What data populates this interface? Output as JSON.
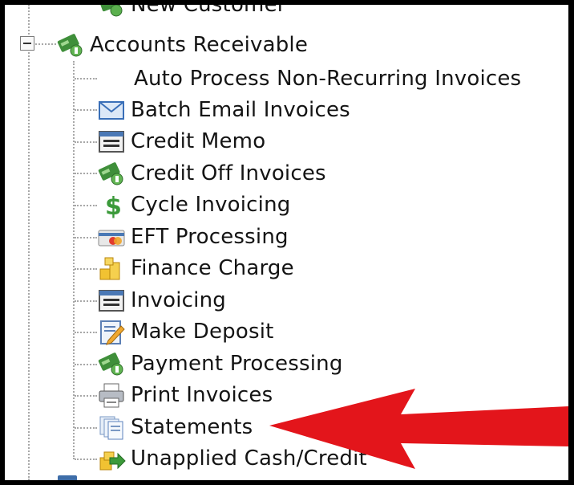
{
  "tree": {
    "top_item": {
      "label": "New Customer",
      "icon": "money-icon"
    },
    "group": {
      "label": "Accounts Receivable",
      "icon": "money-icon",
      "expanded": true,
      "toggle_icon": "collapse-minus-icon"
    },
    "items": [
      {
        "label": "Auto Process Non-Recurring Invoices",
        "icon": "none"
      },
      {
        "label": "Batch Email Invoices",
        "icon": "envelope-icon"
      },
      {
        "label": "Credit Memo",
        "icon": "form-icon"
      },
      {
        "label": "Credit Off Invoices",
        "icon": "money-icon"
      },
      {
        "label": "Cycle Invoicing",
        "icon": "dollar-sign-icon"
      },
      {
        "label": "EFT Processing",
        "icon": "credit-card-icon"
      },
      {
        "label": "Finance Charge",
        "icon": "coins-icon"
      },
      {
        "label": "Invoicing",
        "icon": "form-icon"
      },
      {
        "label": "Make Deposit",
        "icon": "deposit-slip-icon"
      },
      {
        "label": "Payment Processing",
        "icon": "money-icon"
      },
      {
        "label": "Print Invoices",
        "icon": "printer-icon"
      },
      {
        "label": "Statements",
        "icon": "stacked-documents-icon"
      },
      {
        "label": "Unapplied Cash/Credit",
        "icon": "coins-arrow-icon"
      }
    ]
  },
  "annotation": {
    "icon": "red-arrow-icon",
    "color": "#e3151b",
    "points_to": "Statements"
  },
  "colors": {
    "background": "#ffffff",
    "frame": "#000000",
    "tree_lines": "#a8a8a8",
    "text": "#141414"
  }
}
